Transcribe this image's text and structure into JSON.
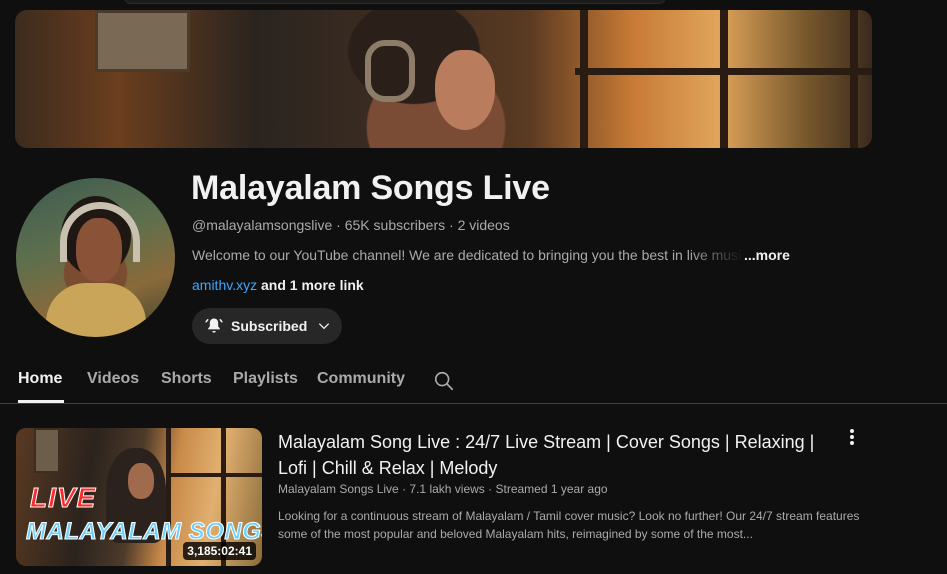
{
  "channel": {
    "name": "Malayalam Songs Live",
    "handle": "@malayalamsongslive",
    "subscribers": "65K subscribers",
    "video_count": "2 videos",
    "description": "Welcome to our YouTube channel! We are dedicated to bringing you the best in live music",
    "more_label": "...more",
    "link": "amithv.xyz",
    "extra_links": "and 1 more link",
    "subscribe_label": "Subscribed"
  },
  "tabs": [
    {
      "label": "Home",
      "active": true
    },
    {
      "label": "Videos"
    },
    {
      "label": "Shorts"
    },
    {
      "label": "Playlists"
    },
    {
      "label": "Community"
    }
  ],
  "featured_video": {
    "title": "Malayalam Song Live : 24/7 Live Stream | Cover Songs | Relaxing | Lofi | Chill & Relax | Melody",
    "channel": "Malayalam Songs Live",
    "views": "7.1 lakh views",
    "streamed": "Streamed 1 year ago",
    "description": "Looking for a continuous stream of Malayalam / Tamil cover music? Look no further! Our 24/7 stream features some of the most popular and beloved Malayalam hits, reimagined by some of the most...",
    "duration": "3,185:02:41",
    "thumb_text_live": "LIVE",
    "thumb_text_title": "MALAYALAM SONGS"
  },
  "icons": {
    "bell": "bell-ring-icon",
    "chevron": "chevron-down-icon",
    "search": "search-icon",
    "more": "more-vert-icon"
  },
  "colors": {
    "background": "#0f0f0f",
    "link": "#3ea6ff",
    "button_bg": "#272727",
    "secondary_text": "#aaaaaa"
  }
}
